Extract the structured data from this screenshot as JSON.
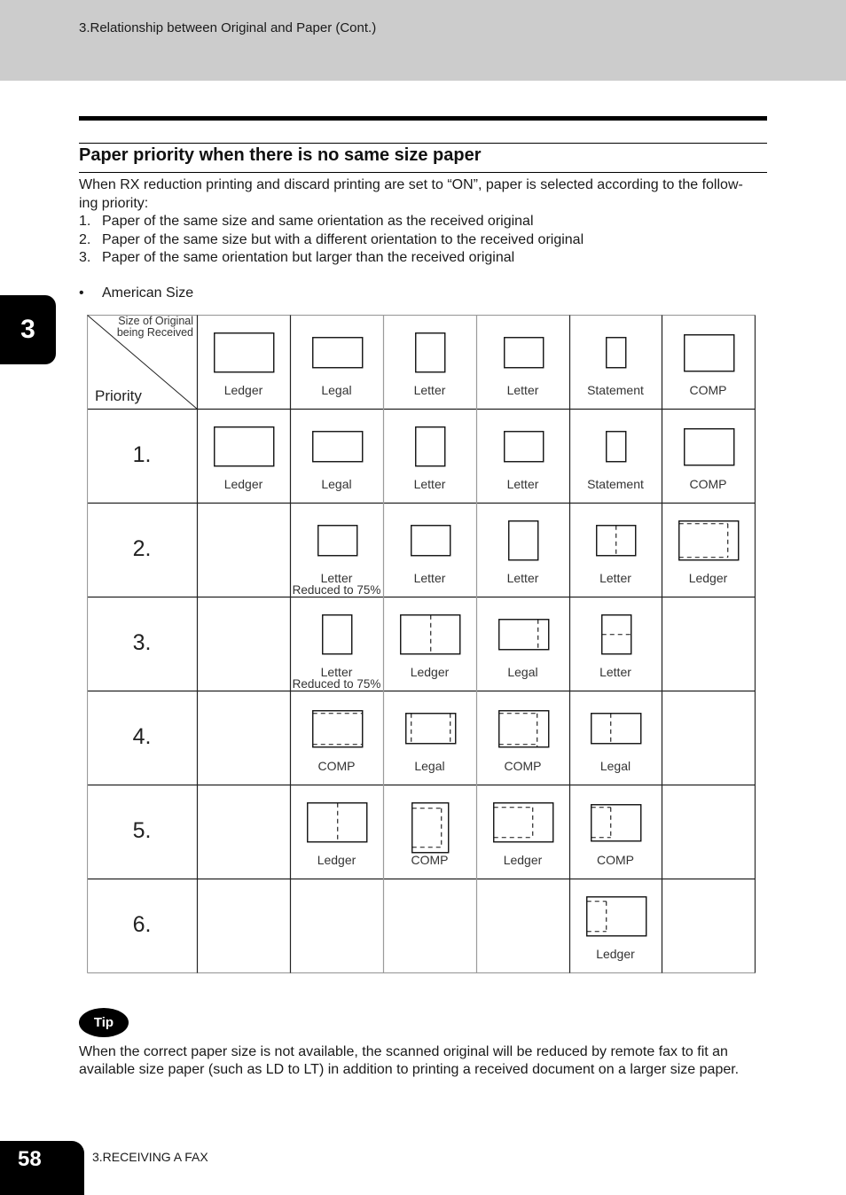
{
  "header": {
    "title": "3.Relationship between Original and Paper (Cont.)"
  },
  "chapter_tab": "3",
  "section": {
    "title": "Paper priority when there is no same size paper",
    "intro_lines": [
      "When RX reduction printing and discard printing are set to “ON”, paper is selected according to the follow-",
      "ing priority:"
    ],
    "priority_rules": [
      {
        "num": "1.",
        "text": "Paper of the same size and same orientation as the received original"
      },
      {
        "num": "2.",
        "text": "Paper of the same size but with a different orientation to the received original"
      },
      {
        "num": "3.",
        "text": "Paper of the same orientation but larger than the received original"
      }
    ],
    "bullet": {
      "symbol": "•",
      "text": "American Size"
    }
  },
  "table": {
    "corner": {
      "top_line1": "Size of Original",
      "top_line2": "being Received",
      "bottom": "Priority"
    },
    "originals": [
      {
        "label": "Ledger",
        "icon": "ledger-landscape"
      },
      {
        "label": "Legal",
        "icon": "legal-landscape"
      },
      {
        "label": "Letter",
        "icon": "letter-portrait"
      },
      {
        "label": "Letter",
        "icon": "letter-landscape"
      },
      {
        "label": "Statement",
        "icon": "statement-portrait"
      },
      {
        "label": "COMP",
        "icon": "comp-landscape"
      }
    ],
    "rows": [
      {
        "priority": "1.",
        "cells": [
          {
            "label": "Ledger",
            "icon": "ledger-landscape"
          },
          {
            "label": "Legal",
            "icon": "legal-landscape"
          },
          {
            "label": "Letter",
            "icon": "letter-portrait"
          },
          {
            "label": "Letter",
            "icon": "letter-landscape"
          },
          {
            "label": "Statement",
            "icon": "statement-portrait"
          },
          {
            "label": "COMP",
            "icon": "comp-landscape"
          }
        ]
      },
      {
        "priority": "2.",
        "cells": [
          null,
          {
            "label": "Letter",
            "sublabel": "Reduced to 75%",
            "icon": "letter-landscape-reduced"
          },
          {
            "label": "Letter",
            "icon": "letter-landscape"
          },
          {
            "label": "Letter",
            "icon": "letter-portrait"
          },
          {
            "label": "Letter",
            "icon": "letter-landscape-statement-fit"
          },
          {
            "label": "Ledger",
            "icon": "ledger-landscape-comp-fit"
          }
        ]
      },
      {
        "priority": "3.",
        "cells": [
          null,
          {
            "label": "Letter",
            "sublabel": "Reduced to 75%",
            "icon": "letter-portrait-reduced"
          },
          {
            "label": "Ledger",
            "icon": "ledger-landscape-legal-fit"
          },
          {
            "label": "Legal",
            "icon": "legal-landscape-letter-fit"
          },
          {
            "label": "Letter",
            "icon": "letter-portrait-statement-fit"
          },
          null
        ]
      },
      {
        "priority": "4.",
        "cells": [
          null,
          {
            "label": "COMP",
            "icon": "comp-landscape-ledger-fit"
          },
          {
            "label": "Legal",
            "icon": "legal-landscape-letter-fit"
          },
          {
            "label": "COMP",
            "icon": "comp-landscape-letter-fit"
          },
          {
            "label": "Legal",
            "icon": "legal-landscape-statement-fit"
          },
          null
        ]
      },
      {
        "priority": "5.",
        "cells": [
          null,
          {
            "label": "Ledger",
            "icon": "ledger-landscape-legal-fit"
          },
          {
            "label": "COMP",
            "icon": "comp-portrait-letter-fit"
          },
          {
            "label": "Ledger",
            "icon": "ledger-landscape-letter-fit"
          },
          {
            "label": "COMP",
            "icon": "comp-landscape-statement-fit"
          },
          null
        ]
      },
      {
        "priority": "6.",
        "cells": [
          null,
          null,
          null,
          null,
          {
            "label": "Ledger",
            "icon": "ledger-landscape-statement-fit"
          },
          null
        ]
      }
    ]
  },
  "tip": {
    "badge": "Tip",
    "text_lines": [
      "When the correct paper size is not available, the scanned original will be reduced by remote fax to fit an",
      "available size paper (such as LD to LT) in addition to printing a received document on a larger size paper."
    ]
  },
  "footer": {
    "page_number": "58",
    "chapter": "3.RECEIVING A FAX"
  }
}
